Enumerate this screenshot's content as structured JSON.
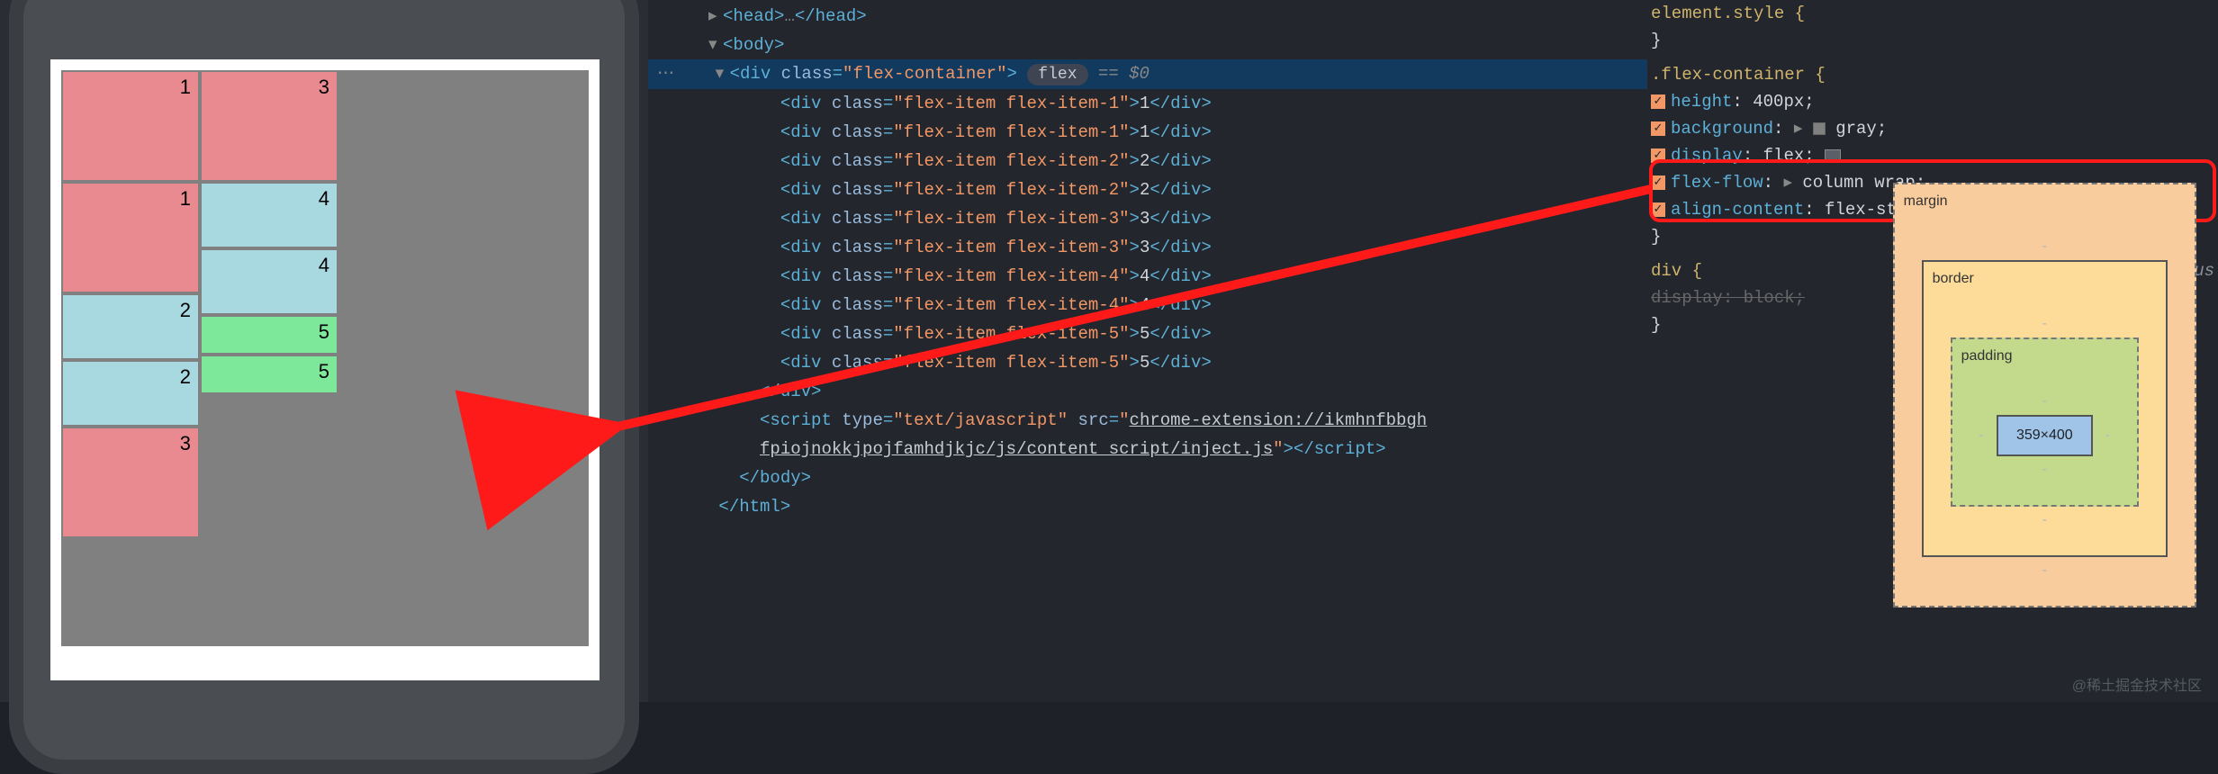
{
  "phone_demo": {
    "items": [
      "1",
      "1",
      "2",
      "2",
      "3",
      "3",
      "4",
      "4",
      "5",
      "5"
    ]
  },
  "dom": {
    "head_open": "<head>",
    "head_ell": "…",
    "head_close": "</head>",
    "body_open": "<body>",
    "selected": {
      "tag_open": "<div ",
      "attr": "class",
      "eq": "=",
      "val": "\"flex-container\"",
      "tag_close": ">",
      "badge": "flex",
      "dollar": "== $0"
    },
    "children": [
      {
        "cls": "flex-item flex-item-1",
        "txt": "1"
      },
      {
        "cls": "flex-item flex-item-1",
        "txt": "1"
      },
      {
        "cls": "flex-item flex-item-2",
        "txt": "2"
      },
      {
        "cls": "flex-item flex-item-2",
        "txt": "2"
      },
      {
        "cls": "flex-item flex-item-3",
        "txt": "3"
      },
      {
        "cls": "flex-item flex-item-3",
        "txt": "3"
      },
      {
        "cls": "flex-item flex-item-4",
        "txt": "4"
      },
      {
        "cls": "flex-item flex-item-4",
        "txt": "4"
      },
      {
        "cls": "flex-item flex-item-5",
        "txt": "5"
      },
      {
        "cls": "flex-item flex-item-5",
        "txt": "5"
      }
    ],
    "div_close": "</div>",
    "script": {
      "open": "<script ",
      "type_attr": "type",
      "type_val": "\"text/javascript\"",
      "src_attr": "src",
      "src_val_1": "chrome-extension://ikmhnfbbgh",
      "src_val_2": "fpiojnokkjpojfamhdjkjc/js/content_script/inject.js",
      "close": "></script>"
    },
    "body_close": "</body>",
    "html_close": "</html>"
  },
  "styles": {
    "element_style": "element.style {",
    "element_style_close": "}",
    "flex_container": ".flex-container {",
    "rules": {
      "height": {
        "p": "height",
        "v": "400px"
      },
      "background": {
        "p": "background",
        "v": "gray"
      },
      "display": {
        "p": "display",
        "v": "flex"
      },
      "flex_flow": {
        "p": "flex-flow",
        "v": "column wrap"
      },
      "align_content": {
        "p": "align-content",
        "v": "flex-start"
      }
    },
    "flex_container_close": "}",
    "div_rule": "div {",
    "div_display": "display: block;",
    "div_close": "}",
    "us": "us"
  },
  "box_model": {
    "margin": "margin",
    "border": "border",
    "padding": "padding",
    "content": "359×400",
    "dash": "-"
  },
  "watermark": "@稀土掘金技术社区"
}
